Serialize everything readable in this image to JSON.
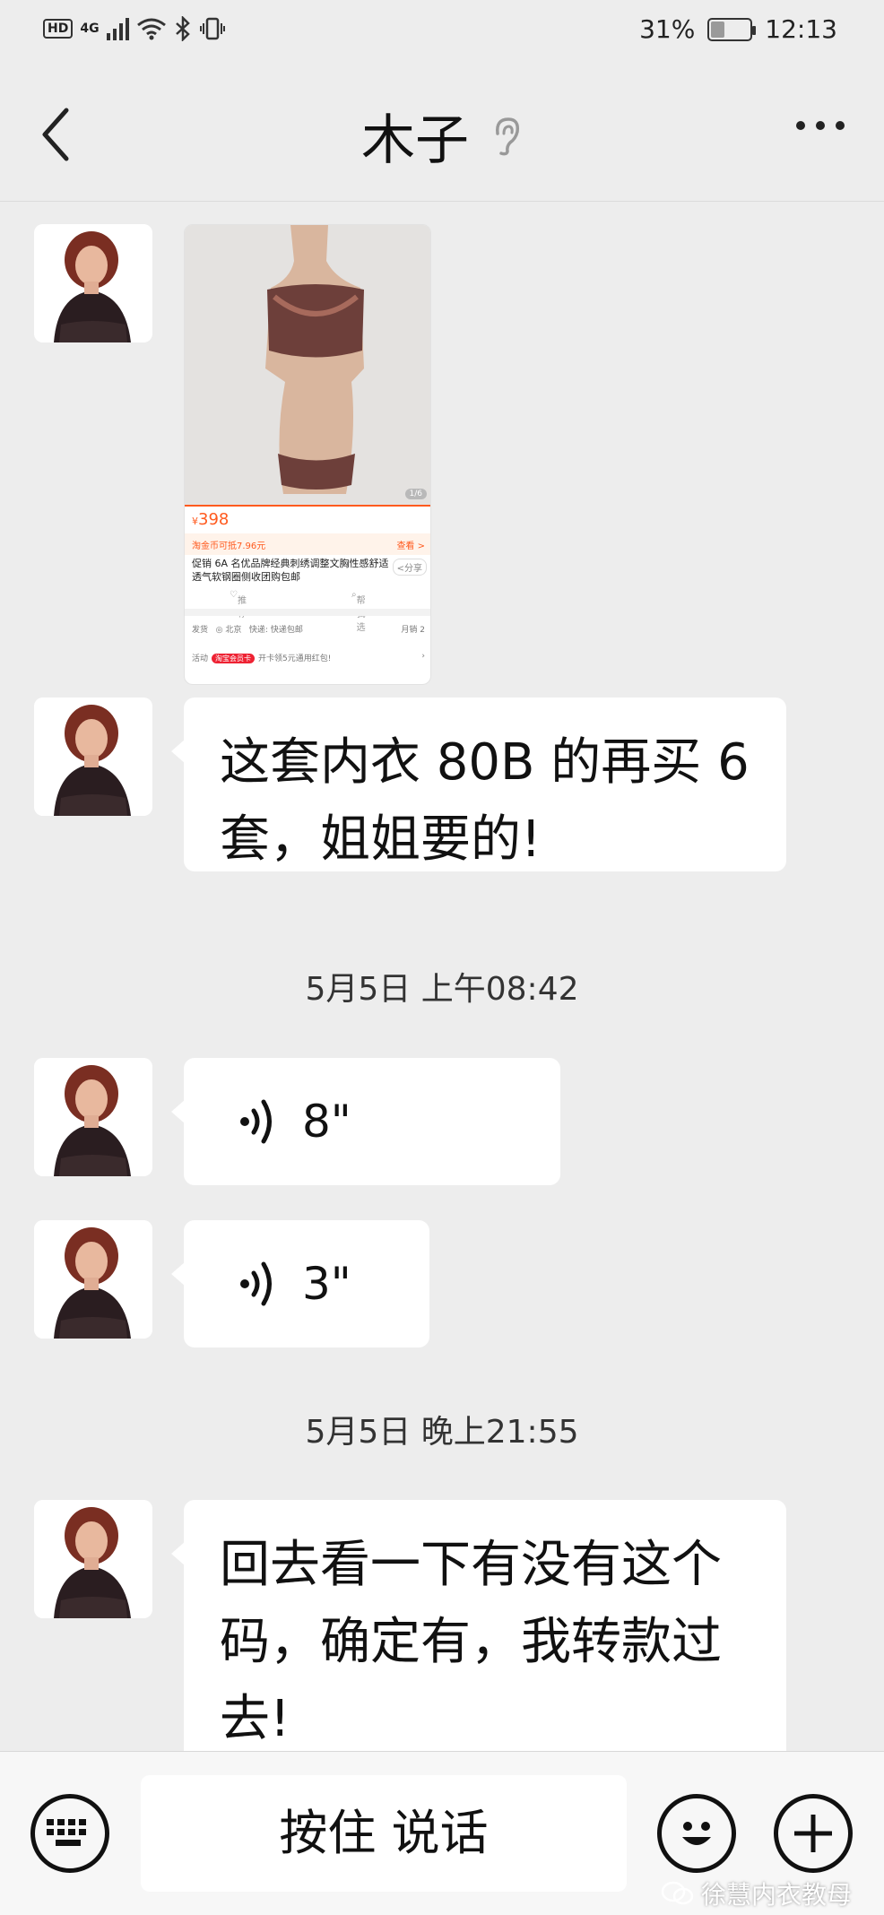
{
  "status_bar": {
    "hd": "HD",
    "network": "4G",
    "battery": "31%",
    "battery_level": 0.31,
    "time": "12:13"
  },
  "header": {
    "title": "木子"
  },
  "messages": {
    "product": {
      "currency": "¥",
      "price": "398",
      "coin_text": "淘金币可抵7.96元",
      "look": "查看 >",
      "badge": "1/6",
      "description": "促销 6A 名优品牌经典刺绣调整文胸性感舒适透气软钢圈侧收团购包邮",
      "share": "分享",
      "favorite": "推荐",
      "help": "帮我选",
      "ship_label": "发货",
      "ship_from": "北京",
      "ship_method": "快递: 快递包邮",
      "monthly_sales": "月销 2",
      "activity_label": "活动",
      "activity_tag": "淘宝会员卡",
      "activity_text": "开卡领5元通用红包!"
    },
    "text1": "这套内衣 80B 的再买 6 套，姐姐要的!",
    "time1": "5月5日 上午08:42",
    "voice1": "8\"",
    "voice2": "3\"",
    "time2": "5月5日 晚上21:55",
    "text2": "回去看一下有没有这个码，确定有，我转款过去!"
  },
  "input_bar": {
    "hold_to_talk": "按住 说话",
    "keyboard_icon": "keyboard-icon",
    "emoji_icon": "emoji-icon",
    "plus_icon": "plus-icon"
  },
  "watermark": "徐慧内衣教母"
}
